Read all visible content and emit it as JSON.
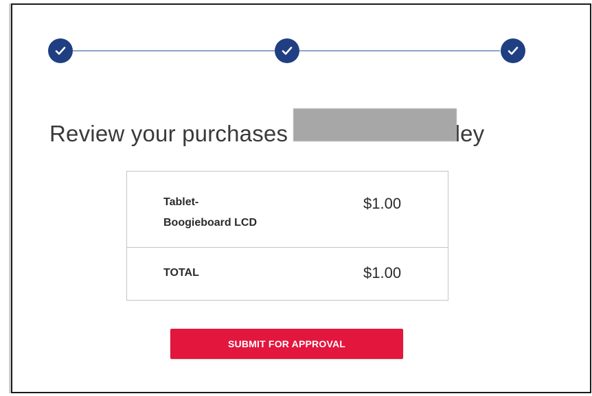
{
  "stepper": {
    "steps": [
      {
        "state": "complete",
        "icon": "check-icon"
      },
      {
        "state": "complete",
        "icon": "check-icon"
      },
      {
        "state": "complete",
        "icon": "check-icon"
      }
    ],
    "colors": {
      "dot": "#1f3f82",
      "line": "#8fa3c4"
    }
  },
  "heading": {
    "prefix": "Review your purchases ",
    "suffix": "ley"
  },
  "summary": {
    "items": [
      {
        "name_line1": "Tablet-",
        "name_line2": "Boogieboard LCD",
        "price": "$1.00"
      }
    ],
    "total_label": "TOTAL",
    "total_price": "$1.00"
  },
  "actions": {
    "submit_label": "SUBMIT FOR APPROVAL",
    "submit_color": "#e3163d"
  }
}
